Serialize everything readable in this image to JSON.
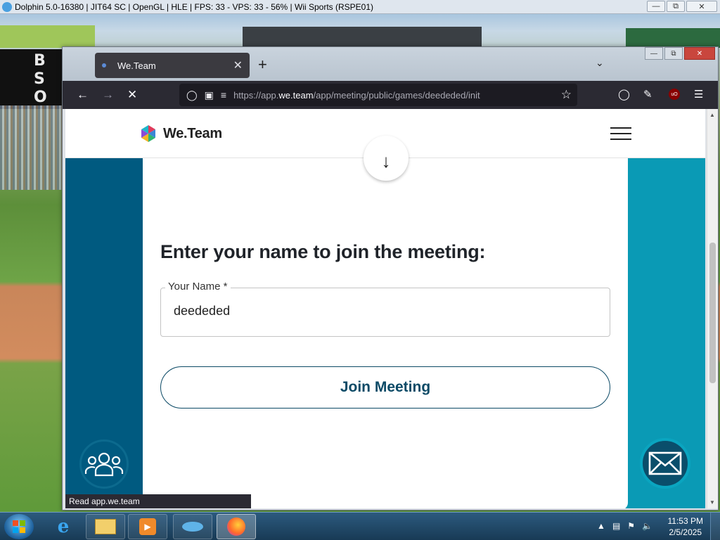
{
  "dolphin": {
    "title": "Dolphin 5.0-16380 | JIT64 SC | OpenGL | HLE | FPS: 33 - VPS: 33 - 56% | Wii Sports (RSPE01)",
    "scoreboard": [
      "B",
      "S",
      "O"
    ]
  },
  "browser": {
    "tab_title": "We.Team",
    "url_prefix": "https://app.",
    "url_domain": "we.team",
    "url_path": "/app/meeting/public/games/deededed/init",
    "status_text": "Read app.we.team"
  },
  "site": {
    "brand": "We.Team",
    "heading": "Enter your name to join the meeting:",
    "name_label": "Your Name *",
    "name_value": "deededed",
    "join_label": "Join Meeting"
  },
  "taskbar": {
    "time": "11:53 PM",
    "date": "2/5/2025"
  },
  "colors": {
    "primary": "#0c4a66",
    "teal": "#0a9ab5",
    "dark_teal": "#005a80"
  }
}
